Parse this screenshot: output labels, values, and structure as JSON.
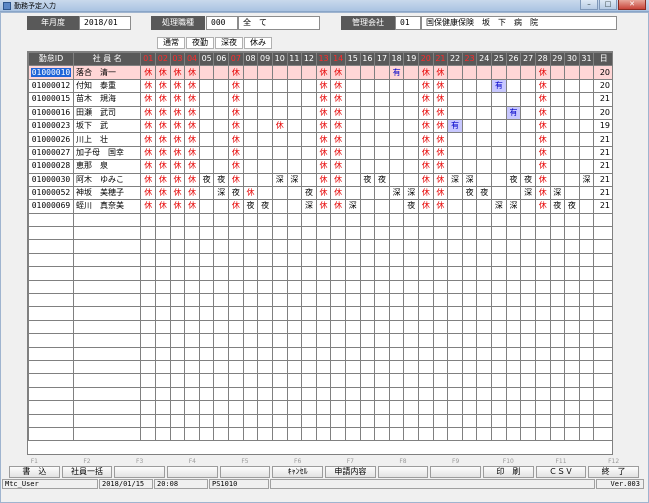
{
  "window": {
    "title": "勤務予定入力"
  },
  "header": {
    "year_month_label": "年月度",
    "year_month_value": "2018/01",
    "job_label": "処理職種",
    "job_code": "000",
    "job_name": "全　て",
    "company_label": "管理会社",
    "company_code": "01",
    "company_name": "国保健康保険　坂　下　病　院"
  },
  "legend": [
    "通常",
    "夜勤",
    "深夜",
    "休み"
  ],
  "table": {
    "col_id": "勤怠ID",
    "col_name": "社 員 名",
    "col_total": "日",
    "days": [
      "01",
      "02",
      "03",
      "04",
      "05",
      "06",
      "07",
      "08",
      "09",
      "10",
      "11",
      "12",
      "13",
      "14",
      "15",
      "16",
      "17",
      "18",
      "19",
      "20",
      "21",
      "22",
      "23",
      "24",
      "25",
      "26",
      "27",
      "28",
      "29",
      "30",
      "31"
    ],
    "red_days": [
      "01",
      "02",
      "03",
      "04",
      "07",
      "13",
      "14",
      "20",
      "21",
      "23"
    ],
    "rows": [
      {
        "id": "01000010",
        "name": "落合　清一",
        "cells": [
          "休",
          "休",
          "休",
          "休",
          "",
          "",
          "休",
          "",
          "",
          "",
          "",
          "",
          "休",
          "休",
          "",
          "",
          "",
          "有",
          "",
          "休",
          "休",
          "",
          "",
          "",
          "",
          "",
          "",
          "休",
          "",
          "",
          ""
        ],
        "total": "20",
        "selected": true
      },
      {
        "id": "01000012",
        "name": "付知　泰重",
        "cells": [
          "休",
          "休",
          "休",
          "休",
          "",
          "",
          "休",
          "",
          "",
          "",
          "",
          "",
          "休",
          "休",
          "",
          "",
          "",
          "",
          "",
          "休",
          "休",
          "",
          "",
          "",
          "有",
          "",
          "",
          "休",
          "",
          "",
          ""
        ],
        "total": "20"
      },
      {
        "id": "01000015",
        "name": "苗木　規海",
        "cells": [
          "休",
          "休",
          "休",
          "休",
          "",
          "",
          "休",
          "",
          "",
          "",
          "",
          "",
          "休",
          "休",
          "",
          "",
          "",
          "",
          "",
          "休",
          "休",
          "",
          "",
          "",
          "",
          "",
          "",
          "休",
          "",
          "",
          ""
        ],
        "total": "21"
      },
      {
        "id": "01000016",
        "name": "田瀬　武司",
        "cells": [
          "休",
          "休",
          "休",
          "休",
          "",
          "",
          "休",
          "",
          "",
          "",
          "",
          "",
          "休",
          "休",
          "",
          "",
          "",
          "",
          "",
          "休",
          "休",
          "",
          "",
          "",
          "",
          "有",
          "",
          "休",
          "",
          "",
          ""
        ],
        "total": "20"
      },
      {
        "id": "01000023",
        "name": "坂下　武",
        "cells": [
          "休",
          "休",
          "休",
          "休",
          "",
          "",
          "休",
          "",
          "",
          "休",
          "",
          "",
          "休",
          "休",
          "",
          "",
          "",
          "",
          "",
          "休",
          "休",
          "有",
          "",
          "",
          "",
          "",
          "",
          "休",
          "",
          "",
          ""
        ],
        "total": "19"
      },
      {
        "id": "01000026",
        "name": "川上　壮",
        "cells": [
          "休",
          "休",
          "休",
          "休",
          "",
          "",
          "休",
          "",
          "",
          "",
          "",
          "",
          "休",
          "休",
          "",
          "",
          "",
          "",
          "",
          "休",
          "休",
          "",
          "",
          "",
          "",
          "",
          "",
          "休",
          "",
          "",
          ""
        ],
        "total": "21"
      },
      {
        "id": "01000027",
        "name": "加子母　国幸",
        "cells": [
          "休",
          "休",
          "休",
          "休",
          "",
          "",
          "休",
          "",
          "",
          "",
          "",
          "",
          "休",
          "休",
          "",
          "",
          "",
          "",
          "",
          "休",
          "休",
          "",
          "",
          "",
          "",
          "",
          "",
          "休",
          "",
          "",
          ""
        ],
        "total": "21"
      },
      {
        "id": "01000028",
        "name": "恵那　泉",
        "cells": [
          "休",
          "休",
          "休",
          "休",
          "",
          "",
          "休",
          "",
          "",
          "",
          "",
          "",
          "休",
          "休",
          "",
          "",
          "",
          "",
          "",
          "休",
          "休",
          "",
          "",
          "",
          "",
          "",
          "",
          "休",
          "",
          "",
          ""
        ],
        "total": "21"
      },
      {
        "id": "01000030",
        "name": "阿木　ゆみこ",
        "cells": [
          "休",
          "休",
          "休",
          "休",
          "夜",
          "夜",
          "休",
          "",
          "",
          "深",
          "深",
          "",
          "休",
          "休",
          "",
          "夜",
          "夜",
          "",
          "",
          "休",
          "休",
          "深",
          "深",
          "",
          "",
          "夜",
          "夜",
          "休",
          "",
          "",
          "深"
        ],
        "total": "21"
      },
      {
        "id": "01000052",
        "name": "神坂　美穂子",
        "cells": [
          "休",
          "休",
          "休",
          "休",
          "",
          "深",
          "夜",
          "休",
          "",
          "",
          "",
          "夜",
          "休",
          "休",
          "",
          "",
          "",
          "深",
          "深",
          "休",
          "休",
          "",
          "夜",
          "夜",
          "",
          "",
          "深",
          "休",
          "深",
          "",
          ""
        ],
        "total": "21"
      },
      {
        "id": "01000069",
        "name": "蛭川　真奈美",
        "cells": [
          "休",
          "休",
          "休",
          "休",
          "",
          "",
          "休",
          "夜",
          "夜",
          "",
          "",
          "深",
          "休",
          "休",
          "深",
          "",
          "",
          "",
          "夜",
          "休",
          "休",
          "",
          "",
          "",
          "深",
          "深",
          "",
          "休",
          "夜",
          "夜",
          ""
        ],
        "total": "21"
      }
    ],
    "empty_rows": 17
  },
  "fkeys": [
    {
      "num": "F1",
      "label": "書　込"
    },
    {
      "num": "F2",
      "label": "社員一括"
    },
    {
      "num": "F3",
      "label": ""
    },
    {
      "num": "F4",
      "label": ""
    },
    {
      "num": "F5",
      "label": ""
    },
    {
      "num": "F6",
      "label": "ｷｬﾝｾﾙ"
    },
    {
      "num": "F7",
      "label": "申請内容"
    },
    {
      "num": "F8",
      "label": ""
    },
    {
      "num": "F9",
      "label": ""
    },
    {
      "num": "F10",
      "label": "印　刷"
    },
    {
      "num": "F11",
      "label": "ＣＳＶ"
    },
    {
      "num": "F12",
      "label": "終　了"
    }
  ],
  "status": {
    "user": "Mtc_User",
    "date": "2018/01/15",
    "time": "20:08",
    "form": "PS1010",
    "version": "Ver.003"
  },
  "colors": {
    "header_bg": "#595959",
    "holiday_red": "#e60000",
    "paid_leave_bg": "#c8c8ff",
    "selected_row_bg": "#ffd6d6"
  }
}
